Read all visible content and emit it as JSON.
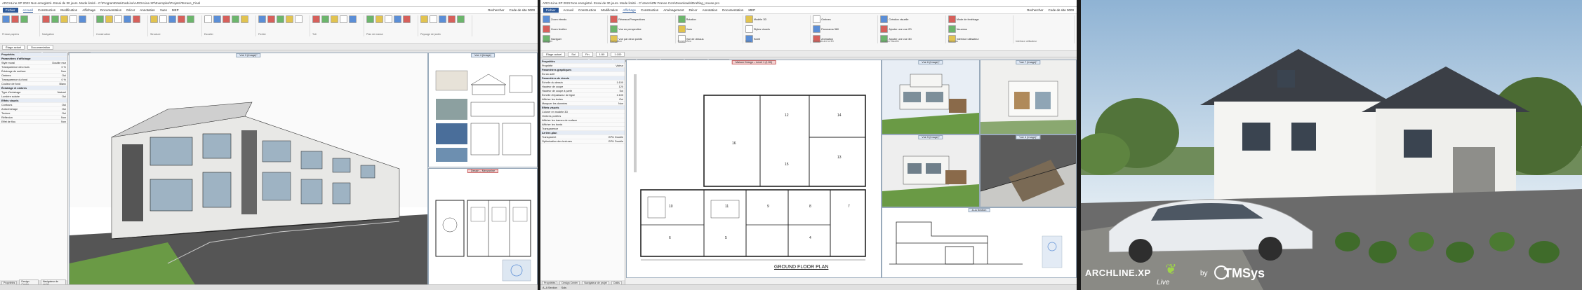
{
  "left_window": {
    "title": "ARCHLine.XP 2022 Non enregistré. Essai de 30 jours. Mode limité - C:\\ProgramData\\CadLine\\ARCHLine.XP\\Exemples\\Projets\\Terrace_Final",
    "menu": [
      "Fichier",
      "Accueil",
      "Construction",
      "Modification",
      "Affichage",
      "Documentation",
      "Décor",
      "Annotation",
      "Vues",
      "MEP"
    ],
    "active_menu": "Accueil",
    "search_label": "Rechercher",
    "site_code": "Code de site 0000",
    "ribbon_groups": [
      "Presse-papiers",
      "Navigation",
      "Construction",
      "Structure",
      "Escalier",
      "Fichier",
      "Toit",
      "Plan de masse",
      "Paysage de jardin"
    ],
    "toolrow": [
      "Étage actuel",
      "Documentation"
    ],
    "tabs": [
      "Mezzanine",
      "Dessin RDC",
      "Vue 3 (Image)*",
      "Vue 4 (Image)"
    ],
    "panel_title": "Propriétés",
    "panel_rows": [
      {
        "k": "Paramètres d'affichage",
        "v": "",
        "h": true
      },
      {
        "k": "Style mural",
        "v": "Double mur"
      },
      {
        "k": "Transparence des murs",
        "v": "0 %"
      },
      {
        "k": "Éclairage de surface",
        "v": "Non"
      },
      {
        "k": "Ombres",
        "v": "Oui"
      },
      {
        "k": "Transparence du fond",
        "v": "0 %"
      },
      {
        "k": "Couleur de fond",
        "v": "Blanc"
      },
      {
        "k": "Éclairage et ombres",
        "v": "",
        "h": true
      },
      {
        "k": "Type d'éclairage",
        "v": "Naturel"
      },
      {
        "k": "Lumière solaire",
        "v": "Oui"
      },
      {
        "k": "Effets visuels",
        "v": "",
        "h": true
      },
      {
        "k": "Contours",
        "v": "Oui"
      },
      {
        "k": "Anticrénelage",
        "v": "Oui"
      },
      {
        "k": "Texture",
        "v": "Oui"
      },
      {
        "k": "Réflexion",
        "v": "Non"
      },
      {
        "k": "Effet de flou",
        "v": "Non"
      }
    ],
    "panel_bottom_tabs": [
      "Propriétés",
      "Design Center",
      "Navigateur de projet"
    ],
    "view_headers": {
      "main3d": "Vue 3 (Image)*",
      "thumbs": "Vue 4 (Image)",
      "plan": "Dessin – Mezzanine"
    }
  },
  "middle_window": {
    "title": "ARCHLine.XP 2022 Non enregistré. Essai de 30 jours. Mode limité - C:\\Users\\ZM France Com\\Downloads\\Drafting_House.pro",
    "menu": [
      "Fichier",
      "Accueil",
      "Construction",
      "Modification",
      "Affichage",
      "Construction",
      "Aménagement",
      "Décor",
      "Annotation",
      "Documentation",
      "MEP"
    ],
    "active_menu": "Affichage",
    "search_label": "Rechercher",
    "site_code": "Code de site 0000",
    "ribbon_labels": [
      "Zoom étendu",
      "Zoom fenêtre",
      "Naviguer",
      "Réseaux/Perspectives",
      "Vue en perspective",
      "Vue par deux points",
      "Rotation",
      "Vues",
      "Vue de dessus",
      "Modèle 3D",
      "Styles visuels",
      "Soleil",
      "Ombres",
      "Panorama 360",
      "Animation",
      "Création visuelle",
      "Ajouter une vue 2D",
      "Ajouter une vue 3D",
      "Mode de fenêtrage",
      "Nouveau",
      "Interface utilisateur"
    ],
    "ribbon_groups": [
      "Naviguer",
      "Navigation",
      "Rotate View",
      "Vues",
      "Reconstruire la 3D",
      "Création visuelle",
      "Nouveau",
      "Interface utilisateur"
    ],
    "toolrow": [
      "Étage actuel",
      "Sol",
      "Fin",
      "1:50",
      "1:100"
    ],
    "tabs": [
      "Maison Design - Level 1 (FR-XXX)",
      "Vue 2 (Image)",
      "Vue 3 (Image)",
      "Vue 4 (Image)",
      "Vue 5 (Image)",
      "Vue 6 (Image)",
      "A–A Section"
    ],
    "panel_title": "Propriétés",
    "panel_head": {
      "k": "Propriété",
      "v": "Valeur"
    },
    "panel_rows": [
      {
        "k": "Paramètres graphiques",
        "v": "",
        "h": true
      },
      {
        "k": "Écran actif",
        "v": ""
      },
      {
        "k": "Paramètres de dessin",
        "v": "",
        "h": true
      },
      {
        "k": "Échelle du dessin",
        "v": "1:100"
      },
      {
        "k": "Hauteur de coupe",
        "v": "120"
      },
      {
        "k": "Hauteur de coupe à partir",
        "v": "Sol"
      },
      {
        "k": "Échelle d'épaisseur de ligne",
        "v": "1:100"
      },
      {
        "k": "Afficher les textes",
        "v": "Oui"
      },
      {
        "k": "Masquer les données",
        "v": "Non"
      },
      {
        "k": "Effets visuels",
        "v": "",
        "h": true
      },
      {
        "k": "Colorer en modèle 3D",
        "v": ""
      },
      {
        "k": "Ombres portées",
        "v": ""
      },
      {
        "k": "Afficher les trames de surface",
        "v": ""
      },
      {
        "k": "Afficher les bords",
        "v": ""
      },
      {
        "k": "Transparence",
        "v": ""
      },
      {
        "k": "Arrière-plan",
        "v": "",
        "h": true
      },
      {
        "k": "Transparent",
        "v": "GPU Double"
      },
      {
        "k": "Optimisation des textures",
        "v": "GPU Double"
      }
    ],
    "panel_bottom_tabs": [
      "Propriétés",
      "Design Center",
      "Navigateur de projet",
      "Outils"
    ],
    "plan_header": "Maison Design – Level 1 (1:50)",
    "floor_plan_title": "GROUND FLOOR PLAN",
    "room_numbers": [
      "12",
      "14",
      "13",
      "15",
      "16",
      "10",
      "11",
      "9",
      "8",
      "7",
      "6",
      "5",
      "4"
    ],
    "view_headers": [
      "Vue 6 (Image)*",
      "Vue 7 (Image)*",
      "Vue 5 (Image)*",
      "Vue 4 (Image)*",
      "A–A Section"
    ],
    "status": [
      "A–A Section",
      "Sols"
    ]
  },
  "right_panel": {
    "brand_text": "ARCHLINE.XP",
    "live_text": "Live",
    "by_text": "by",
    "company": "TMSys"
  },
  "colors": {
    "accent": "#2b5797",
    "sky": "#c3d6e6",
    "grass": "#5a8a3a",
    "house_wall": "#f4f4f2",
    "roof": "#3b3f46",
    "tmsys": "#ffffff"
  }
}
